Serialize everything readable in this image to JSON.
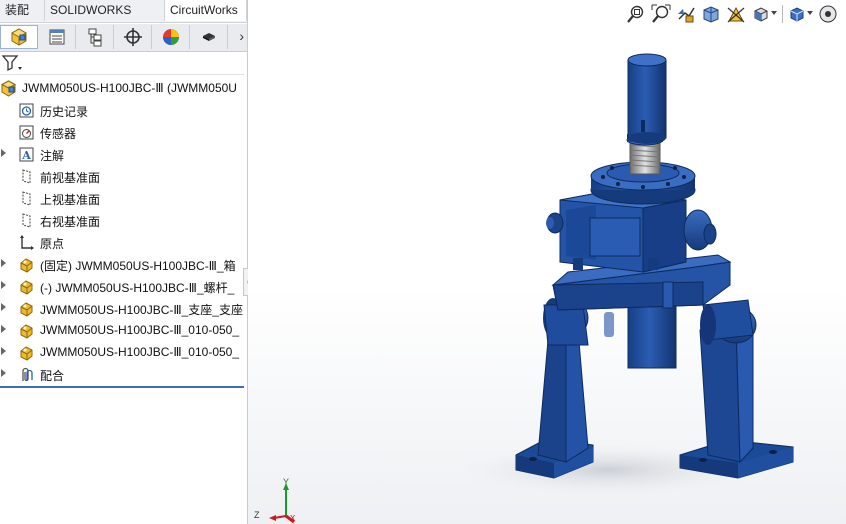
{
  "tabs": [
    "装配体",
    "SOLIDWORKS MBD",
    "CircuitWorks"
  ],
  "manager_tabs": [
    {
      "name": "featuremanager-tab",
      "icon": "assembly-cube-icon"
    },
    {
      "name": "propertymanager-tab",
      "icon": "property-list-icon"
    },
    {
      "name": "configurationmanager-tab",
      "icon": "configuration-icon"
    },
    {
      "name": "dimxpert-tab",
      "icon": "crosshair-icon"
    },
    {
      "name": "display-manager-tab",
      "icon": "appearance-pie-icon"
    },
    {
      "name": "cam-tab",
      "icon": "chip-icon"
    }
  ],
  "manager_more": "›",
  "filter_icon": "filter-icon",
  "tree": {
    "root": "JWMM050US-H100JBC-Ⅲ  (JWMM050U",
    "items": [
      {
        "label": "历史记录",
        "icon": "history-icon",
        "expandable": false
      },
      {
        "label": "传感器",
        "icon": "sensor-icon",
        "expandable": false
      },
      {
        "label": "注解",
        "icon": "annotation-icon",
        "expandable": true
      },
      {
        "label": "前视基准面",
        "icon": "plane-icon",
        "expandable": false
      },
      {
        "label": "上视基准面",
        "icon": "plane-icon",
        "expandable": false
      },
      {
        "label": "右视基准面",
        "icon": "plane-icon",
        "expandable": false
      },
      {
        "label": "原点",
        "icon": "origin-icon",
        "expandable": false
      },
      {
        "label": "(固定) JWMM050US-H100JBC-Ⅲ_箱",
        "icon": "part-icon",
        "expandable": true
      },
      {
        "label": "(-) JWMM050US-H100JBC-Ⅲ_螺杆_",
        "icon": "part-icon",
        "expandable": true
      },
      {
        "label": "JWMM050US-H100JBC-Ⅲ_支座_支座",
        "icon": "part-icon",
        "expandable": true
      },
      {
        "label": "JWMM050US-H100JBC-Ⅲ_010-050_",
        "icon": "part-icon",
        "expandable": true
      },
      {
        "label": "JWMM050US-H100JBC-Ⅲ_010-050_",
        "icon": "part-icon",
        "expandable": true
      },
      {
        "label": "配合",
        "icon": "mates-icon",
        "expandable": true
      }
    ]
  },
  "heads_up_toolbar": [
    "zoom-to-fit-icon",
    "zoom-to-area-icon",
    "previous-view-icon",
    "section-view-icon",
    "dynamic-annotation-icon",
    "view-orientation-icon",
    "display-style-icon"
  ],
  "triad": {
    "x": "X",
    "y": "Y",
    "z": "Z"
  },
  "colors": {
    "model_blue": "#1f4e9c",
    "model_dark": "#112f66",
    "model_light": "#3f73c4",
    "selection_line": "#3d6fb8"
  }
}
